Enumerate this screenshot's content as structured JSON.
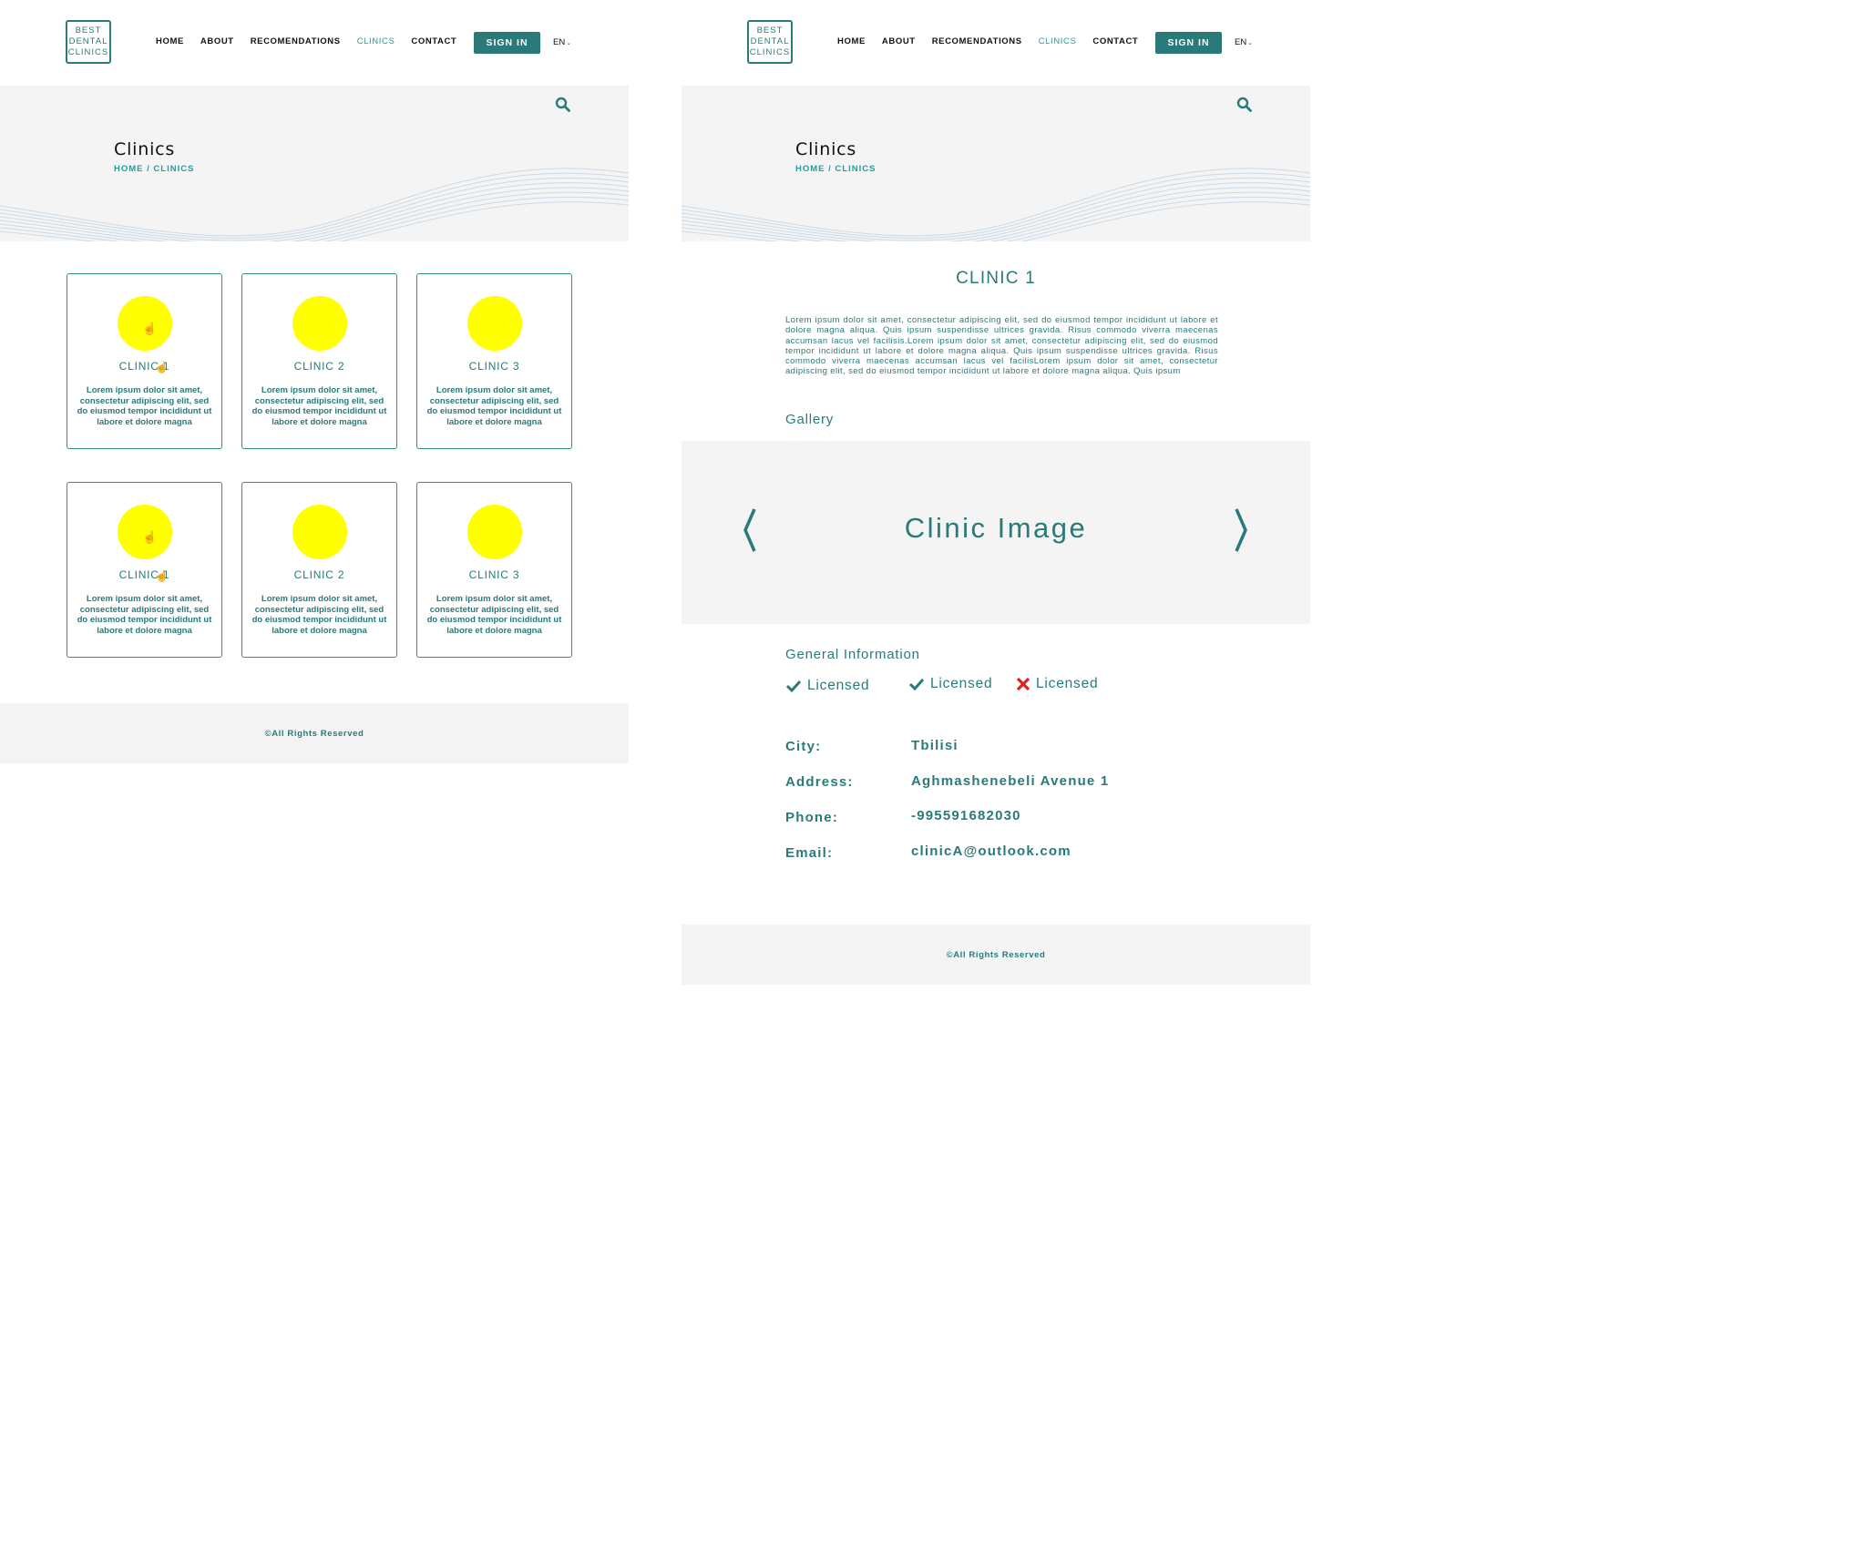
{
  "brand": {
    "logo_lines": [
      "BEST",
      "DENTAL",
      "CLINICS"
    ]
  },
  "nav": {
    "home": "HOME",
    "about": "ABOUT",
    "recommendations": "RECOMENDATIONS",
    "clinics": "CLINICS",
    "contact": "CONTACT"
  },
  "header": {
    "signin_label": "SIGN IN",
    "language": "EN"
  },
  "hero": {
    "title": "Clinics",
    "breadcrumb": "HOME / CLINICS"
  },
  "cards": [
    {
      "name": "CLINIC 1",
      "desc": "Lorem ipsum dolor sit amet, consectetur adipiscing elit, sed do eiusmod tempor incididunt ut labore et dolore magna"
    },
    {
      "name": "CLINIC 2",
      "desc": "Lorem ipsum dolor sit amet, consectetur adipiscing elit, sed do eiusmod tempor incididunt ut labore et dolore magna"
    },
    {
      "name": "CLINIC 3",
      "desc": "Lorem ipsum dolor sit amet, consectetur adipiscing elit, sed do eiusmod tempor incididunt ut labore et dolore magna"
    },
    {
      "name": "CLINIC 1",
      "desc": "Lorem ipsum dolor sit amet, consectetur adipiscing elit, sed do eiusmod tempor incididunt ut labore et dolore magna"
    },
    {
      "name": "CLINIC 2",
      "desc": "Lorem ipsum dolor sit amet, consectetur adipiscing elit, sed do eiusmod tempor incididunt ut labore et dolore magna"
    },
    {
      "name": "CLINIC 3",
      "desc": "Lorem ipsum dolor sit amet, consectetur adipiscing elit, sed do eiusmod tempor incididunt ut labore et dolore magna"
    }
  ],
  "footer": {
    "text": "©All Rights Reserved"
  },
  "detail": {
    "title": "CLINIC 1",
    "description": "Lorem ipsum dolor sit amet, consectetur adipiscing elit, sed do eiusmod tempor incididunt ut labore et dolore magna aliqua. Quis ipsum suspendisse ultrices gravida. Risus commodo viverra maecenas accumsan lacus vel facilisis.Lorem ipsum dolor sit amet, consectetur adipiscing elit, sed do eiusmod tempor incididunt ut labore et dolore magna aliqua. Quis ipsum suspendisse ultrices gravida. Risus commodo viverra maecenas accumsan lacus vel facilisLorem ipsum dolor sit amet, consectetur adipiscing elit, sed do eiusmod tempor incididunt ut labore et dolore magna aliqua. Quis ipsum",
    "gallery_label": "Gallery",
    "gallery_image_label": "Clinic Image",
    "general_info_label": "General Information",
    "licenses": [
      {
        "label": "Licensed",
        "status": "check"
      },
      {
        "label": "Licensed",
        "status": "check"
      },
      {
        "label": "Licensed",
        "status": "cross"
      }
    ],
    "info": [
      {
        "key": "City:",
        "value": "Tbilisi"
      },
      {
        "key": "Address:",
        "value": "Aghmashenebeli Avenue 1"
      },
      {
        "key": "Phone:",
        "value": "-995591682030"
      },
      {
        "key": "Email:",
        "value": "clinicA@outlook.com"
      }
    ]
  },
  "colors": {
    "primary": "#2a7a7a",
    "accent_light": "#2a9a9a",
    "placeholder_yellow": "#ffff00",
    "panel_bg": "#f4f4f4",
    "cross_red": "#e02020"
  },
  "icons": [
    "search-icon",
    "chevron-left-icon",
    "chevron-right-icon",
    "check-icon",
    "cross-icon",
    "hand-cursor-icon"
  ]
}
